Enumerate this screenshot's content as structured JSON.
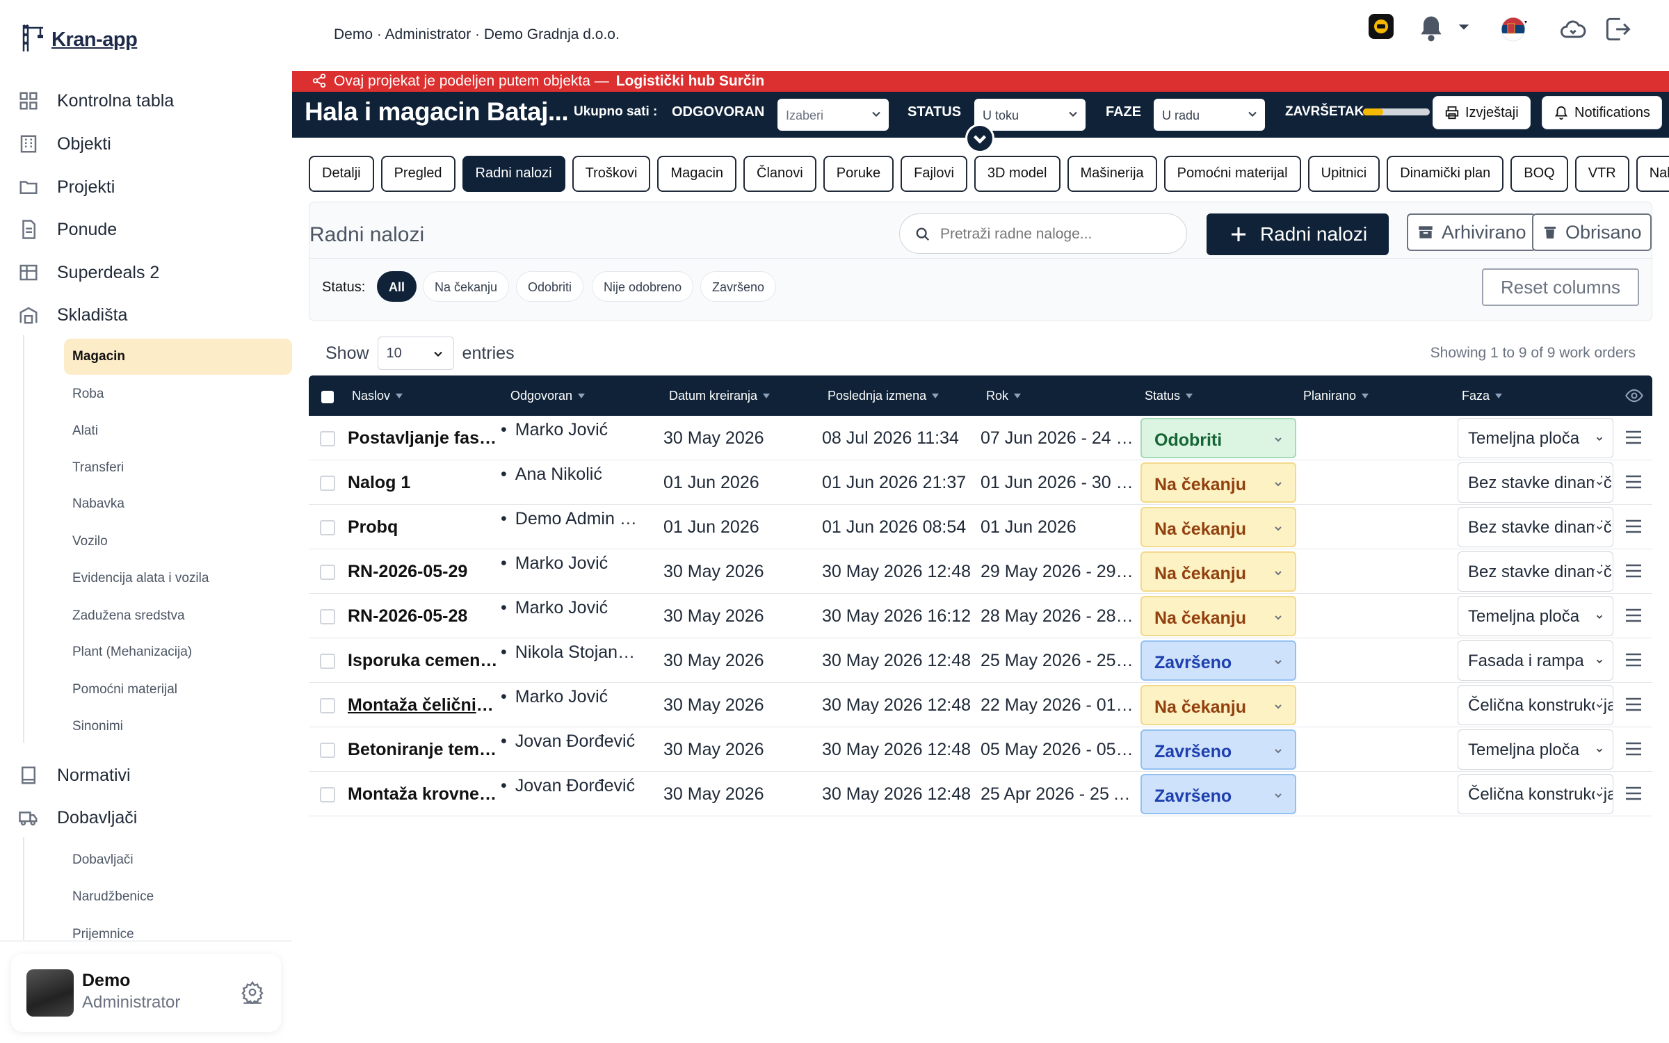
{
  "app": {
    "logo_text": "Kran-app"
  },
  "sidebar": {
    "main_items": [
      {
        "label": "Kontrolna tabla",
        "icon": "dashboard-icon"
      },
      {
        "label": "Objekti",
        "icon": "building-icon"
      },
      {
        "label": "Projekti",
        "icon": "folder-icon"
      },
      {
        "label": "Ponude",
        "icon": "document-icon"
      },
      {
        "label": "Superdeals 2",
        "icon": "table-icon"
      },
      {
        "label": "Skladišta",
        "icon": "warehouse-icon"
      }
    ],
    "warehouse_items": [
      "Magacin",
      "Roba",
      "Alati",
      "Transferi",
      "Nabavka",
      "Vozilo",
      "Evidencija alata i vozila",
      "Zadužena sredstva",
      "Plant (Mehanizacija)",
      "Pomoćni materijal",
      "Sinonimi"
    ],
    "normativi": "Normativi",
    "dobavljaci": "Dobavljači",
    "supplier_items": [
      "Dobavljači",
      "Narudžbenice",
      "Prijemnice"
    ],
    "user": {
      "name": "Demo",
      "role": "Administrator"
    }
  },
  "topbar": {
    "company": "Demo · Administrator · Demo Gradnja d.o.o."
  },
  "banner": {
    "text": "Ovaj projekat je podeljen putem objekta —",
    "link": "Logistički hub Surčin"
  },
  "project": {
    "title": "Hala i magacin Bataj...",
    "hours_label": "Ukupno sati :",
    "responsible_label": "ODGOVORAN",
    "responsible_placeholder": "Izaberi",
    "status_label": "STATUS",
    "status_value": "U toku",
    "phase_label": "FAZE",
    "phase_value": "U radu",
    "completion_label": "ZAVRŠETAK",
    "completion_fraction": 0.3,
    "reports_button": "Izvještaji",
    "notifications_button": "Notifications"
  },
  "tabs": [
    "Detalji",
    "Pregled",
    "Radni nalozi",
    "Troškovi",
    "Magacin",
    "Članovi",
    "Poruke",
    "Fajlovi",
    "3D model",
    "Mašinerija",
    "Pomoćni materijal",
    "Upitnici",
    "Dinamički plan",
    "BOQ",
    "VTR",
    "Nab"
  ],
  "active_tab": "Radni nalozi",
  "work_orders": {
    "title": "Radni nalozi",
    "search_placeholder": "Pretraži radne naloge...",
    "add_button": "Radni nalozi",
    "archived_button": "Arhivirano",
    "deleted_button": "Obrisano",
    "status_label": "Status:",
    "filters": [
      "All",
      "Na čekanju",
      "Odobriti",
      "Nije odobreno",
      "Završeno"
    ],
    "reset_columns": "Reset columns",
    "show_label": "Show",
    "entries_value": "10",
    "entries_label": "entries",
    "showing_text": "Showing 1 to 9 of 9 work orders",
    "columns": [
      "Naslov",
      "Odgovoran",
      "Datum kreiranja",
      "Poslednja izmena",
      "Rok",
      "Status",
      "Planirano",
      "Faza"
    ],
    "rows": [
      {
        "title": "Postavljanje fasad...",
        "responsible": "Marko Jović",
        "created": "30 May 2026",
        "modified": "08 Jul 2026 11:34",
        "due": "07 Jun 2026 - 24 J...",
        "status": "Odobriti",
        "phase": "Temeljna ploča"
      },
      {
        "title": "Nalog 1",
        "responsible": "Ana Nikolić",
        "created": "01 Jun 2026",
        "modified": "01 Jun 2026 21:37",
        "due": "01 Jun 2026 - 30 J...",
        "status": "Na čekanju",
        "phase": "Bez stavke dinamičkog"
      },
      {
        "title": "Probq",
        "responsible": "Demo Admin rez",
        "created": "01 Jun 2026",
        "modified": "01 Jun 2026 08:54",
        "due": "01 Jun 2026",
        "status": "Na čekanju",
        "phase": "Bez stavke dinamičkog"
      },
      {
        "title": "RN-2026-05-29",
        "responsible": "Marko Jović",
        "created": "30 May 2026",
        "modified": "30 May 2026 12:48",
        "due": "29 May 2026 - 29 ...",
        "status": "Na čekanju",
        "phase": "Bez stavke dinamičkog"
      },
      {
        "title": "RN-2026-05-28",
        "responsible": "Marko Jović",
        "created": "30 May 2026",
        "modified": "30 May 2026 16:12",
        "due": "28 May 2026 - 28 ...",
        "status": "Na čekanju",
        "phase": "Temeljna ploča"
      },
      {
        "title": "Isporuka cementa ...",
        "responsible": "Nikola Stojanović",
        "created": "30 May 2026",
        "modified": "30 May 2026 12:48",
        "due": "25 May 2026 - 25 ...",
        "status": "Završeno",
        "phase": "Fasada i rampa"
      },
      {
        "title": "Montaža čeličnih s...",
        "responsible": "Marko Jović",
        "created": "30 May 2026",
        "modified": "30 May 2026 12:48",
        "due": "22 May 2026 - 01 ...",
        "status": "Na čekanju",
        "phase": "Čelična konstrukcija"
      },
      {
        "title": "Betoniranje temelj...",
        "responsible": "Jovan Đorđević",
        "created": "30 May 2026",
        "modified": "30 May 2026 12:48",
        "due": "05 May 2026 - 05 ...",
        "status": "Završeno",
        "phase": "Temeljna ploča"
      },
      {
        "title": "Montaža krovne k...",
        "responsible": "Jovan Đorđević",
        "created": "30 May 2026",
        "modified": "30 May 2026 12:48",
        "due": "25 Apr 2026 - 25 A...",
        "status": "Završeno",
        "phase": "Čelična konstrukcija"
      }
    ]
  },
  "colors": {
    "navy": "#0f2238",
    "banner_red": "#dc2f2f",
    "accent_yellow": "#f5b800",
    "active_sub": "#fdecc8"
  }
}
